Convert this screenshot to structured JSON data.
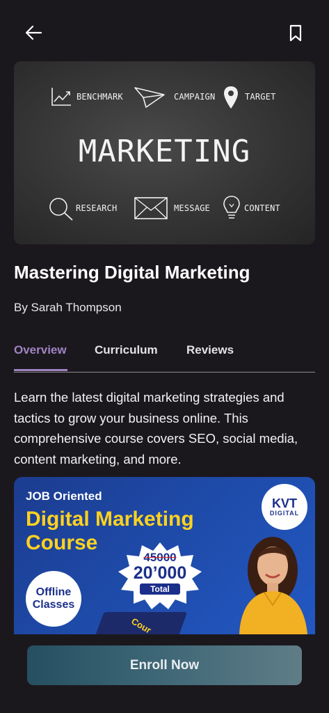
{
  "header": {
    "back_icon": "arrow-left-icon",
    "bookmark_icon": "bookmark-icon"
  },
  "hero": {
    "main_word": "MARKETING",
    "labels": {
      "benchmark": "BENCHMARK",
      "campaign": "CAMPAIGN",
      "target": "TARGET",
      "research": "RESEARCH",
      "message": "MESSAGE",
      "content": "CONTENT"
    }
  },
  "course": {
    "title": "Mastering Digital Marketing",
    "author": "By Sarah Thompson",
    "description": "Learn the latest digital marketing strategies and tactics to grow your business online. This comprehensive course covers SEO, social media, content marketing, and more."
  },
  "tabs": [
    {
      "label": "Overview",
      "active": true
    },
    {
      "label": "Curriculum",
      "active": false
    },
    {
      "label": "Reviews",
      "active": false
    }
  ],
  "promo": {
    "pretitle": "JOB Oriented",
    "title_line1": "Digital Marketing",
    "title_line2": "Course",
    "logo_main": "KVT",
    "logo_sub": "DIGITAL",
    "old_price": "45000",
    "new_price": "20’000",
    "price_caption": "Total",
    "offline_line1": "Offline",
    "offline_line2": "Classes",
    "course_tag": "Cour"
  },
  "actions": {
    "enroll_label": "Enroll Now"
  },
  "colors": {
    "background": "#1b181d",
    "accent": "#a083c4",
    "promo_yellow": "#ffd21f",
    "promo_blue": "#1e4aa8"
  }
}
